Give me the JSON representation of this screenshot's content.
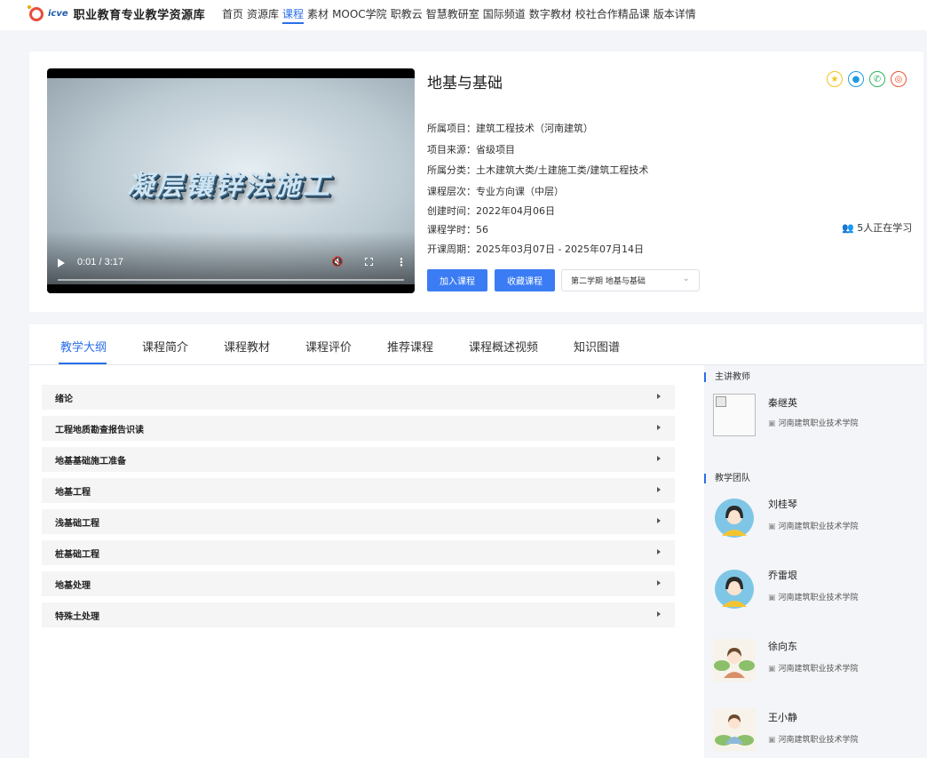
{
  "header": {
    "logo_abbr": "icve",
    "logo_text": "职业教育专业教学资源库",
    "nav": [
      "首页",
      "资源库",
      "课程",
      "素材",
      "MOOC学院",
      "职教云",
      "智慧教研室",
      "国际频道",
      "数字教材",
      "校社合作精品课",
      "版本详情"
    ],
    "active_nav": "课程"
  },
  "video": {
    "overlay_title": "凝层镶锌法施工",
    "time": "0:01 / 3:17",
    "play_icon": "play-icon",
    "mute_icon": "mute-icon",
    "fullscreen_icon": "fullscreen-icon",
    "more_icon": "more-vertical-icon"
  },
  "course": {
    "title": "地基与基础",
    "info": [
      "所属项目：建筑工程技术（河南建筑）",
      "项目来源：省级项目",
      "所属分类：土木建筑大类/土建施工类/建筑工程技术",
      "课程层次：专业方向课（中层）",
      "创建时间：2022年04月06日",
      "课程学时：56",
      "开课周期：2025年03月07日 - 2025年07月14日"
    ],
    "learners": "5人正在学习",
    "join_button": "加入课程",
    "favorite_button": "收藏课程",
    "term_select": "第二学期 地基与基础",
    "share_icons": [
      {
        "name": "qzone-icon",
        "color": "#f5c518",
        "glyph": "★"
      },
      {
        "name": "qq-icon",
        "color": "#1e9ae0",
        "glyph": "●"
      },
      {
        "name": "wechat-icon",
        "color": "#2db35d",
        "glyph": "✆"
      },
      {
        "name": "weibo-icon",
        "color": "#e8542e",
        "glyph": "◎"
      }
    ]
  },
  "tabs": [
    "教学大纲",
    "课程简介",
    "课程教材",
    "课程评价",
    "推荐课程",
    "课程概述视频",
    "知识图谱"
  ],
  "active_tab": "教学大纲",
  "chapters": [
    "绪论",
    "工程地质勘查报告识读",
    "地基基础施工准备",
    "地基工程",
    "浅基础工程",
    "桩基础工程",
    "地基处理",
    "特殊土处理"
  ],
  "lead_teacher_heading": "主讲教师",
  "team_heading": "教学团队",
  "lead_teacher": {
    "name": "秦继英",
    "school": "河南建筑职业技术学院"
  },
  "team": [
    {
      "name": "刘桂琴",
      "school": "河南建筑职业技术学院"
    },
    {
      "name": "乔雷垠",
      "school": "河南建筑职业技术学院"
    },
    {
      "name": "徐向东",
      "school": "河南建筑职业技术学院"
    },
    {
      "name": "王小静",
      "school": "河南建筑职业技术学院"
    }
  ]
}
